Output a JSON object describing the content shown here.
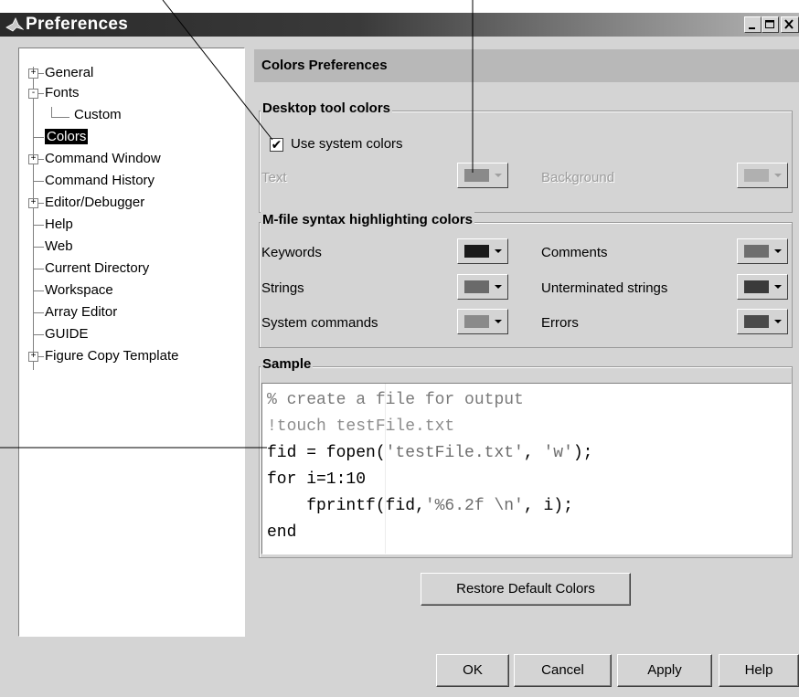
{
  "window": {
    "title": "Preferences",
    "controls": [
      "minimize",
      "maximize",
      "close"
    ]
  },
  "tree": {
    "items": [
      {
        "label": "General",
        "expander": "+"
      },
      {
        "label": "Fonts",
        "expander": "-"
      },
      {
        "label": "Custom",
        "expander": ""
      },
      {
        "label": "Colors",
        "expander": "",
        "selected": true
      },
      {
        "label": "Command Window",
        "expander": "+"
      },
      {
        "label": "Command History",
        "expander": ""
      },
      {
        "label": "Editor/Debugger",
        "expander": "+"
      },
      {
        "label": "Help",
        "expander": ""
      },
      {
        "label": "Web",
        "expander": ""
      },
      {
        "label": "Current Directory",
        "expander": ""
      },
      {
        "label": "Workspace",
        "expander": ""
      },
      {
        "label": "Array Editor",
        "expander": ""
      },
      {
        "label": "GUIDE",
        "expander": ""
      },
      {
        "label": "Figure Copy Template",
        "expander": "+"
      }
    ]
  },
  "panel": {
    "title": "Colors Preferences",
    "desktop_group": {
      "title": "Desktop tool colors",
      "use_system_colors_label": "Use system colors",
      "use_system_colors_checked": "✔",
      "text_label": "Text",
      "background_label": "Background",
      "text_color": "#8a8a8a",
      "background_color": "#b0b0b0"
    },
    "syntax_group": {
      "title": "M-file syntax highlighting colors",
      "keywords_label": "Keywords",
      "strings_label": "Strings",
      "system_commands_label": "System commands",
      "comments_label": "Comments",
      "unterminated_label": "Unterminated strings",
      "errors_label": "Errors",
      "keywords_color": "#1a1a1a",
      "strings_color": "#6a6a6a",
      "system_commands_color": "#8a8a8a",
      "comments_color": "#6e6e6e",
      "unterminated_color": "#3a3a3a",
      "errors_color": "#4a4a4a"
    },
    "sample_group": {
      "title": "Sample",
      "code": {
        "line1": "% create a file for output",
        "line2": "!touch testFile.txt",
        "line3_pre": "fid = fopen(",
        "line3_str1": "'testFile.txt'",
        "line3_mid": ", ",
        "line3_str2": "'w'",
        "line3_post": ");",
        "line4": "for i=1:10",
        "line5_pre": "    fprintf(fid,",
        "line5_str": "'%6.2f \\n",
        "line5_post": ", i);",
        "line6": "end"
      }
    },
    "restore_label": "Restore Default Colors"
  },
  "buttons": {
    "ok": "OK",
    "cancel": "Cancel",
    "apply": "Apply",
    "help": "Help"
  }
}
